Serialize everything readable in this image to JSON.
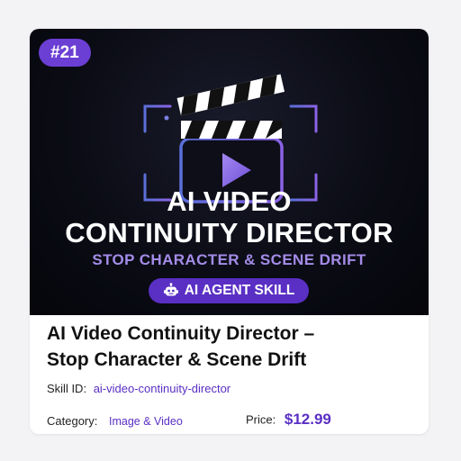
{
  "badge": "#21",
  "hero": {
    "title_line1": "AI VIDEO",
    "title_line2": "CONTINUITY DIRECTOR",
    "subtitle": "STOP CHARACTER & SCENE DRIFT",
    "pill_label": "AI AGENT SKILL",
    "icons": [
      "clapperboard-icon",
      "play-icon",
      "robot-icon"
    ]
  },
  "product": {
    "title_line1": "AI Video Continuity Director –",
    "title_line2": "Stop Character & Scene Drift",
    "skill_id_label": "Skill ID:",
    "skill_id": "ai-video-continuity-director",
    "category_label": "Category:",
    "category": "Image & Video",
    "price_label": "Price:",
    "price": "$12.99"
  },
  "colors": {
    "accent": "#5a2fc4",
    "badge": "#6b3fd4",
    "subtitle": "#a48ce8",
    "hero_bg": "#0b0c15"
  }
}
